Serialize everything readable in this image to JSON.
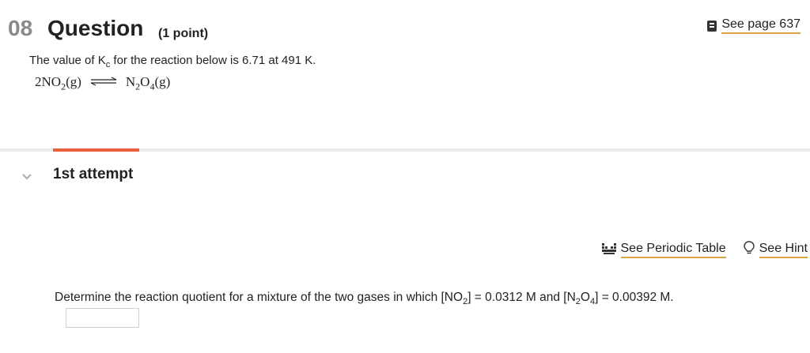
{
  "question": {
    "number": "08",
    "title": "Question",
    "points": "(1 point)",
    "see_page": "See page 637",
    "text_before_k": "The value of K",
    "k_sub": "c",
    "text_after_k": " for the reaction below is 6.71 at 491 K."
  },
  "equation": {
    "left_coef": "2NO",
    "left_sub": "2",
    "left_state": "(g)",
    "right_formula": "N",
    "right_sub1": "2",
    "right_mid": "O",
    "right_sub2": "4",
    "right_state": "(g)"
  },
  "attempt": {
    "label": "1st attempt"
  },
  "tools": {
    "periodic_table": "See Periodic Table",
    "hint": "See Hint"
  },
  "prompt": {
    "p1": "Determine the reaction quotient for a mixture of the two gases in which [NO",
    "s1": "2",
    "p2": "] = 0.0312 M and [N",
    "s2": "2",
    "p3": "O",
    "s3": "4",
    "p4": "] = 0.00392 M."
  },
  "answer": {
    "value": ""
  },
  "colors": {
    "accent_underline": "#d9a441",
    "progress": "#e8613c",
    "divider": "#ebebeb"
  }
}
